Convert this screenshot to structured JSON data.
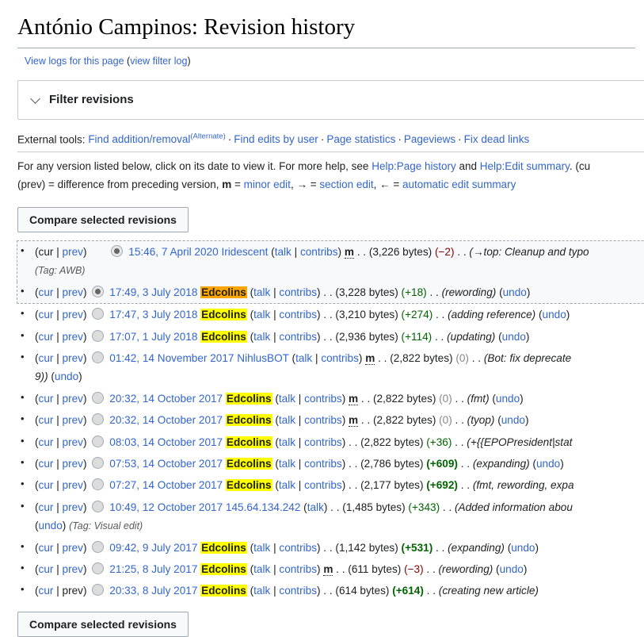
{
  "page": {
    "title": "António Campinos: Revision history",
    "view_logs_text": "View logs for this page",
    "view_filter_log": "view filter log",
    "paren_open": "(",
    "paren_close": ")"
  },
  "filter": {
    "label": "Filter revisions",
    "chevron": "chevron-down-icon"
  },
  "external_tools": {
    "prefix": "External tools:",
    "items": [
      {
        "label": "Find addition/removal",
        "sup": "(Alternate)"
      },
      {
        "label": "Find edits by user",
        "sup": ""
      },
      {
        "label": "Page statistics",
        "sup": ""
      },
      {
        "label": "Pageviews",
        "sup": ""
      },
      {
        "label": "Fix dead links",
        "sup": ""
      }
    ],
    "separator": "·"
  },
  "intro": {
    "line1_a": "For any version listed below, click on its date to view it. For more help, see ",
    "line1_link1": "Help:Page history",
    "line1_b": " and ",
    "line1_link2": "Help:Edit summary",
    "line1_c": ". (cu",
    "line2_a": "(prev) = difference from preceding version, ",
    "line2_m": "m",
    "line2_b": " = ",
    "line2_link1": "minor edit",
    "line2_c": ", → = ",
    "line2_link2": "section edit",
    "line2_d": ", ← = ",
    "line2_link3": "automatic edit summary"
  },
  "compare_button": {
    "top_label": "Compare selected revisions",
    "bottom_label": "Compare selected revisions"
  },
  "labels": {
    "cur": "cur",
    "prev": "prev",
    "pipe": "|",
    "talk": "talk",
    "contribs": "contribs",
    "undo": "undo",
    "minor_m": "m",
    "dots": ". ."
  },
  "revisions": [
    {
      "selected": true,
      "highlight_row": true,
      "radio_on": true,
      "radio_indent": "sp1",
      "cur_is_link": false,
      "prev_is_link": true,
      "date": "15:46, 7 April 2020",
      "user": "Iridescent",
      "user_style": "plain",
      "has_talk": true,
      "has_contribs": true,
      "minor": true,
      "bytes": "(3,226 bytes)",
      "delta": "(−2)",
      "delta_class": "d-neg",
      "comment": "(→top: Cleanup and typo",
      "comment_arrow": true,
      "has_undo": false,
      "tag": "(Tag: AWB)",
      "wrap_second_line": "(Tag: AWB)"
    },
    {
      "selected": true,
      "highlight_row": true,
      "radio_on": true,
      "radio_indent": "sp2",
      "cur_is_link": true,
      "prev_is_link": true,
      "date": "17:49, 3 July 2018",
      "user": "Edcolins",
      "user_style": "orange",
      "has_talk": true,
      "has_contribs": true,
      "minor": false,
      "bytes": "(3,228 bytes)",
      "delta": "(+18)",
      "delta_class": "d-pos",
      "comment": "(rewording)",
      "comment_arrow": false,
      "has_undo": true,
      "tag": ""
    },
    {
      "selected": false,
      "highlight_row": false,
      "radio_on": false,
      "radio_indent": "sp2",
      "cur_is_link": true,
      "prev_is_link": true,
      "date": "17:47, 3 July 2018",
      "user": "Edcolins",
      "user_style": "yellow",
      "has_talk": true,
      "has_contribs": true,
      "minor": false,
      "bytes": "(3,210 bytes)",
      "delta": "(+274)",
      "delta_class": "d-pos",
      "comment": "(adding reference)",
      "comment_arrow": false,
      "has_undo": true,
      "tag": ""
    },
    {
      "selected": false,
      "highlight_row": false,
      "radio_on": false,
      "radio_indent": "sp2",
      "cur_is_link": true,
      "prev_is_link": true,
      "date": "17:07, 1 July 2018",
      "user": "Edcolins",
      "user_style": "yellow",
      "has_talk": true,
      "has_contribs": true,
      "minor": false,
      "bytes": "(2,936 bytes)",
      "delta": "(+114)",
      "delta_class": "d-pos",
      "comment": "(updating)",
      "comment_arrow": false,
      "has_undo": true,
      "tag": ""
    },
    {
      "selected": false,
      "highlight_row": false,
      "radio_on": false,
      "radio_indent": "sp2",
      "cur_is_link": true,
      "prev_is_link": true,
      "date": "01:42, 14 November 2017",
      "user": "NihlusBOT",
      "user_style": "plain",
      "has_talk": true,
      "has_contribs": true,
      "minor": true,
      "bytes": "(2,822 bytes)",
      "delta": "(0)",
      "delta_class": "d-zero",
      "comment": "(Bot: fix deprecate",
      "comment_arrow": false,
      "has_undo": false,
      "tag": "",
      "wrap_second_line": "9)) (undo)"
    },
    {
      "selected": false,
      "highlight_row": false,
      "radio_on": false,
      "radio_indent": "sp2",
      "cur_is_link": true,
      "prev_is_link": true,
      "date": "20:32, 14 October 2017",
      "user": "Edcolins",
      "user_style": "yellow",
      "has_talk": true,
      "has_contribs": true,
      "minor": true,
      "bytes": "(2,822 bytes)",
      "delta": "(0)",
      "delta_class": "d-zero",
      "comment": "(fmt)",
      "comment_arrow": false,
      "has_undo": true,
      "tag": ""
    },
    {
      "selected": false,
      "highlight_row": false,
      "radio_on": false,
      "radio_indent": "sp2",
      "cur_is_link": true,
      "prev_is_link": true,
      "date": "20:32, 14 October 2017",
      "user": "Edcolins",
      "user_style": "yellow",
      "has_talk": true,
      "has_contribs": true,
      "minor": true,
      "bytes": "(2,822 bytes)",
      "delta": "(0)",
      "delta_class": "d-zero",
      "comment": "(tyop)",
      "comment_arrow": false,
      "has_undo": true,
      "tag": ""
    },
    {
      "selected": false,
      "highlight_row": false,
      "radio_on": false,
      "radio_indent": "sp2",
      "cur_is_link": true,
      "prev_is_link": true,
      "date": "08:03, 14 October 2017",
      "user": "Edcolins",
      "user_style": "yellow",
      "has_talk": true,
      "has_contribs": true,
      "minor": false,
      "bytes": "(2,822 bytes)",
      "delta": "(+36)",
      "delta_class": "d-pos",
      "comment": "(+{{EPOPresident|stat",
      "comment_arrow": false,
      "has_undo": false,
      "tag": ""
    },
    {
      "selected": false,
      "highlight_row": false,
      "radio_on": false,
      "radio_indent": "sp2",
      "cur_is_link": true,
      "prev_is_link": true,
      "date": "07:53, 14 October 2017",
      "user": "Edcolins",
      "user_style": "yellow",
      "has_talk": true,
      "has_contribs": true,
      "minor": false,
      "bytes": "(2,786 bytes)",
      "delta": "(+609)",
      "delta_class": "d-pos d-big",
      "comment": "(expanding)",
      "comment_arrow": false,
      "has_undo": true,
      "tag": ""
    },
    {
      "selected": false,
      "highlight_row": false,
      "radio_on": false,
      "radio_indent": "sp2",
      "cur_is_link": true,
      "prev_is_link": true,
      "date": "07:27, 14 October 2017",
      "user": "Edcolins",
      "user_style": "yellow",
      "has_talk": true,
      "has_contribs": true,
      "minor": false,
      "bytes": "(2,177 bytes)",
      "delta": "(+692)",
      "delta_class": "d-pos d-big",
      "comment": "(fmt, rewording, expa",
      "comment_arrow": false,
      "has_undo": false,
      "tag": ""
    },
    {
      "selected": false,
      "highlight_row": false,
      "radio_on": false,
      "radio_indent": "sp2",
      "cur_is_link": true,
      "prev_is_link": true,
      "date": "10:49, 12 October 2017",
      "user": "145.64.134.242",
      "user_style": "plain",
      "has_talk": true,
      "has_contribs": false,
      "minor": false,
      "bytes": "(1,485 bytes)",
      "delta": "(+343)",
      "delta_class": "d-pos",
      "comment": "(Added information abou",
      "comment_arrow": false,
      "has_undo": false,
      "tag": "(Tag: Visual edit)",
      "wrap_second_line": "(undo) (Tag: Visual edit)"
    },
    {
      "selected": false,
      "highlight_row": false,
      "radio_on": false,
      "radio_indent": "sp2",
      "cur_is_link": true,
      "prev_is_link": true,
      "date": "09:42, 9 July 2017",
      "user": "Edcolins",
      "user_style": "yellow",
      "has_talk": true,
      "has_contribs": true,
      "minor": false,
      "bytes": "(1,142 bytes)",
      "delta": "(+531)",
      "delta_class": "d-pos d-big",
      "comment": "(expanding)",
      "comment_arrow": false,
      "has_undo": true,
      "tag": ""
    },
    {
      "selected": false,
      "highlight_row": false,
      "radio_on": false,
      "radio_indent": "sp2",
      "cur_is_link": true,
      "prev_is_link": true,
      "date": "21:25, 8 July 2017",
      "user": "Edcolins",
      "user_style": "yellow",
      "has_talk": true,
      "has_contribs": true,
      "minor": true,
      "bytes": "(611 bytes)",
      "delta": "(−3)",
      "delta_class": "d-neg",
      "comment": "(rewording)",
      "comment_arrow": false,
      "has_undo": true,
      "tag": ""
    },
    {
      "selected": false,
      "highlight_row": false,
      "radio_on": false,
      "radio_indent": "sp2",
      "cur_is_link": true,
      "prev_is_link": false,
      "date": "20:33, 8 July 2017",
      "user": "Edcolins",
      "user_style": "yellow",
      "has_talk": true,
      "has_contribs": true,
      "minor": false,
      "bytes": "(614 bytes)",
      "delta": "(+614)",
      "delta_class": "d-pos d-big",
      "comment": "(creating new article)",
      "comment_arrow": false,
      "has_undo": false,
      "tag": ""
    }
  ],
  "colors": {
    "link": "#3366cc",
    "positive": "#006400",
    "negative": "#8b0000",
    "zero": "#888888",
    "highlight_yellow": "#ffff00",
    "highlight_orange": "#ffa500",
    "border": "#a2a9b1"
  }
}
